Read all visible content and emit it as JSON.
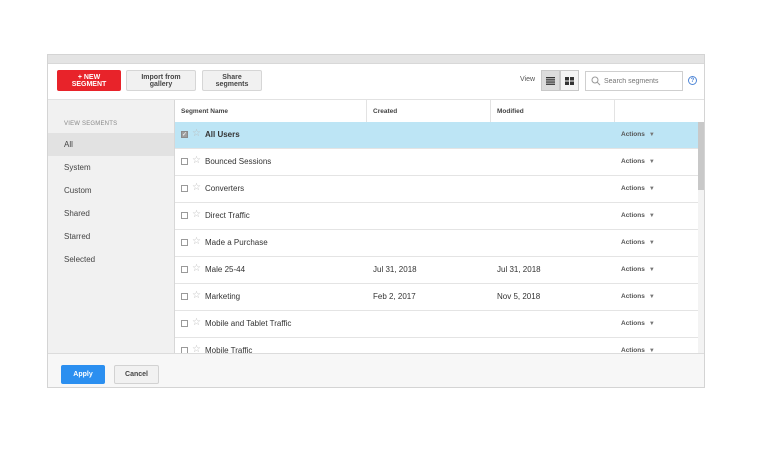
{
  "toolbar": {
    "new_segment": "+ NEW SEGMENT",
    "import_gallery": "Import from gallery",
    "share_segments": "Share segments",
    "view_label": "View",
    "search_placeholder": "Search segments",
    "help": "?"
  },
  "sidebar": {
    "title": "VIEW SEGMENTS",
    "items": [
      {
        "label": "All"
      },
      {
        "label": "System"
      },
      {
        "label": "Custom"
      },
      {
        "label": "Shared"
      },
      {
        "label": "Starred"
      },
      {
        "label": "Selected"
      }
    ]
  },
  "table": {
    "headers": {
      "name": "Segment Name",
      "created": "Created",
      "modified": "Modified"
    },
    "action_label": "Actions",
    "rows": [
      {
        "name": "All Users",
        "created": "",
        "modified": "",
        "checked": true
      },
      {
        "name": "Bounced Sessions",
        "created": "",
        "modified": "",
        "checked": false
      },
      {
        "name": "Converters",
        "created": "",
        "modified": "",
        "checked": false
      },
      {
        "name": "Direct Traffic",
        "created": "",
        "modified": "",
        "checked": false
      },
      {
        "name": "Made a Purchase",
        "created": "",
        "modified": "",
        "checked": false
      },
      {
        "name": "Male 25-44",
        "created": "Jul 31, 2018",
        "modified": "Jul 31, 2018",
        "checked": false
      },
      {
        "name": "Marketing",
        "created": "Feb 2, 2017",
        "modified": "Nov 5, 2018",
        "checked": false
      },
      {
        "name": "Mobile and Tablet Traffic",
        "created": "",
        "modified": "",
        "checked": false
      },
      {
        "name": "Mobile Traffic",
        "created": "",
        "modified": "",
        "checked": false
      }
    ]
  },
  "footer": {
    "apply": "Apply",
    "cancel": "Cancel"
  },
  "colors": {
    "new_segment": "#e8232a",
    "apply": "#2b8ff0",
    "selected_row": "#bde5f5"
  }
}
